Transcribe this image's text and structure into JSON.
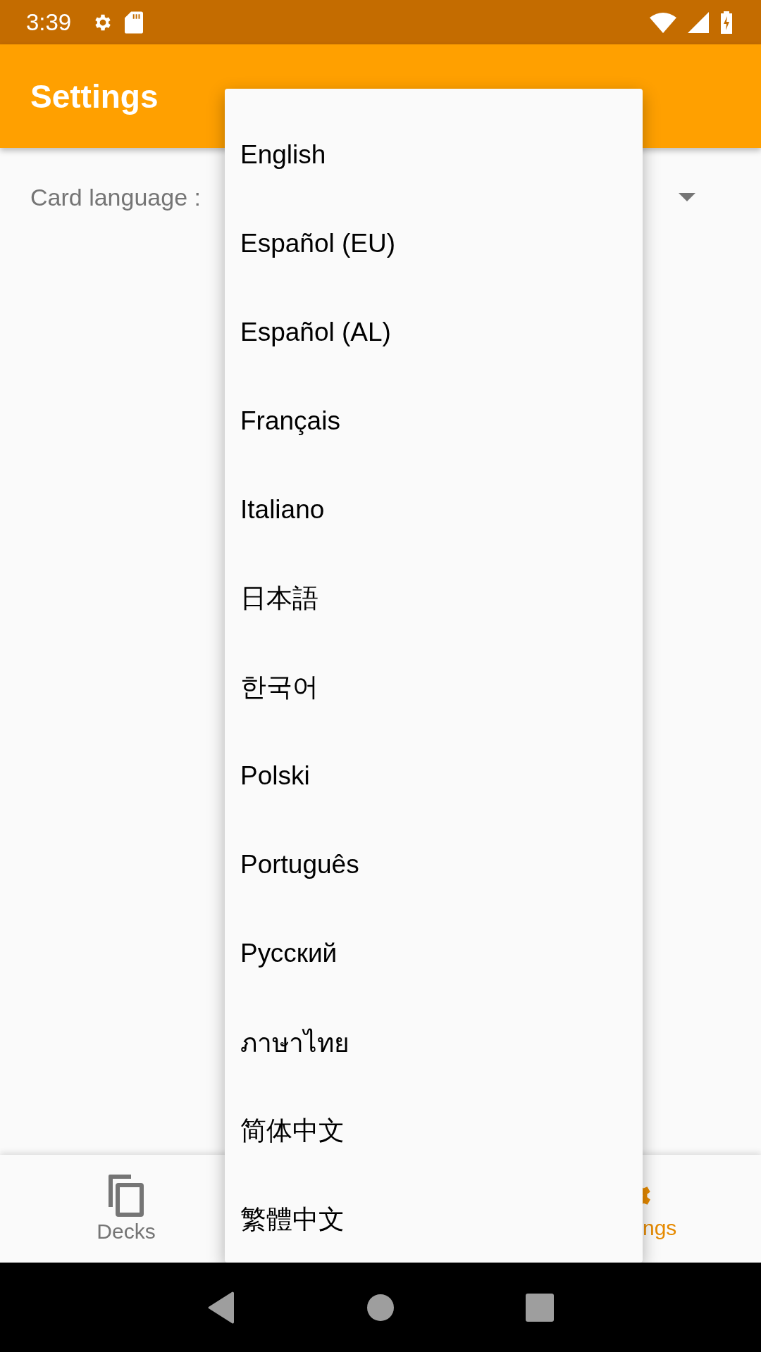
{
  "status_bar": {
    "time": "3:39"
  },
  "app_bar": {
    "title": "Settings"
  },
  "settings": [
    {
      "label": "Card language :"
    }
  ],
  "language_menu": [
    "English",
    "Español (EU)",
    "Español (AL)",
    "Français",
    "Italiano",
    "日本語",
    "한국어",
    "Polski",
    "Português",
    "Русский",
    "ภาษาไทย",
    "简体中文",
    "繁體中文"
  ],
  "bottom_nav": [
    {
      "kind": "decks",
      "label": "Decks",
      "selected": false
    },
    {
      "kind": "settings",
      "label": "ngs",
      "selected": true
    }
  ]
}
